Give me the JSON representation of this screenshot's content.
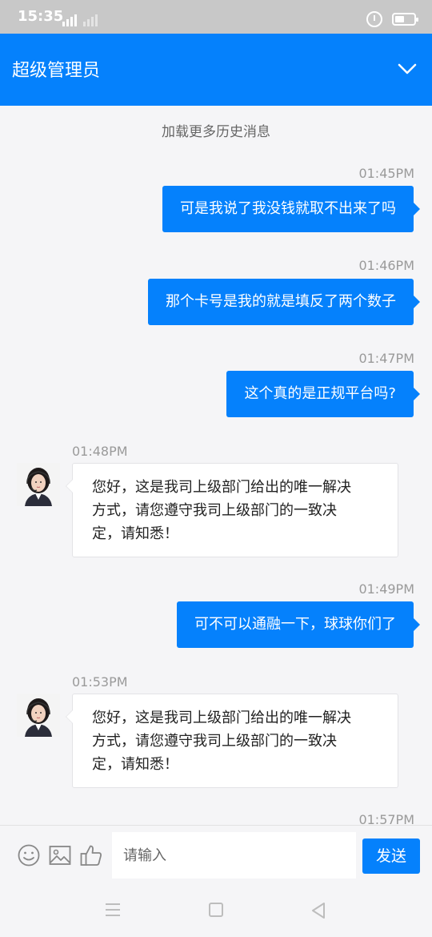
{
  "status_bar": {
    "time": "15:35",
    "network_1": "4G",
    "network_2": "X"
  },
  "header": {
    "title": "超级管理员",
    "dropdown_icon": "chevron-down-icon",
    "background": "#0581fc"
  },
  "chat": {
    "load_more": "加载更多历史消息",
    "messages": [
      {
        "direction": "outgoing",
        "time": "01:45PM",
        "text": "可是我说了我没钱就取不出来了吗"
      },
      {
        "direction": "outgoing",
        "time": "01:46PM",
        "text": "那个卡号是我的就是填反了两个数子"
      },
      {
        "direction": "outgoing",
        "time": "01:47PM",
        "text": "这个真的是正规平台吗?"
      },
      {
        "direction": "incoming",
        "time": "01:48PM",
        "lines": [
          "您好，这是我司上级部门给出的唯一解决",
          "方式，请您遵守我司上级部门的一致决",
          "定，请知悉！"
        ]
      },
      {
        "direction": "outgoing",
        "time": "01:49PM",
        "text": "可不可以通融一下，球球你们了"
      },
      {
        "direction": "incoming",
        "time": "01:53PM",
        "lines": [
          "您好，这是我司上级部门给出的唯一解决",
          "方式，请您遵守我司上级部门的一致决",
          "定，请知悉！"
        ]
      },
      {
        "direction": "outgoing",
        "time": "01:57PM"
      }
    ]
  },
  "input_bar": {
    "emoji_icon": "emoji-icon",
    "image_icon": "image-icon",
    "like_icon": "thumbs-up-icon",
    "placeholder": "请输入",
    "send_label": "发送"
  },
  "nav_bar": {
    "menu_icon": "menu-icon",
    "home_icon": "home-square-icon",
    "back_icon": "back-triangle-icon"
  }
}
